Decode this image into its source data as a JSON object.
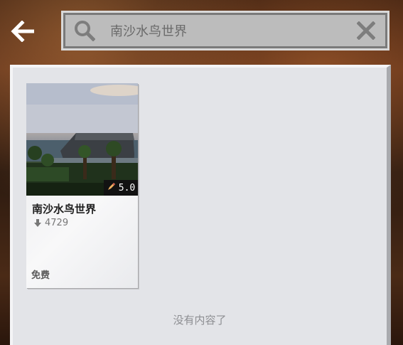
{
  "header": {
    "back_icon": "arrow-left-icon",
    "search": {
      "value": "南沙水鸟世界",
      "icon": "search-icon",
      "clear_icon": "close-icon"
    }
  },
  "results": {
    "items": [
      {
        "title": "南沙水鸟世界",
        "rating": "5.0",
        "rating_icon": "pencil-icon",
        "downloads": "4729",
        "downloads_icon": "download-arrow-icon",
        "price": "免费"
      }
    ],
    "empty_message": "没有内容了"
  }
}
